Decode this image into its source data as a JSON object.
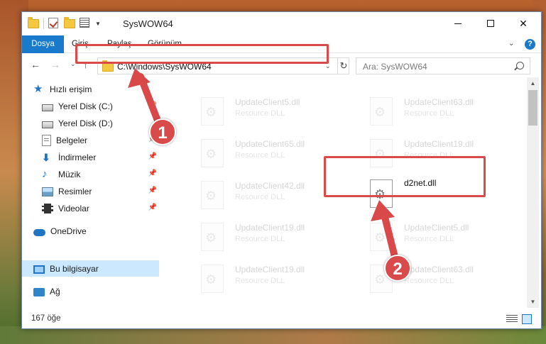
{
  "window": {
    "title": "SysWOW64"
  },
  "ribbon": {
    "tabs": [
      "Dosya",
      "Giriş",
      "Paylaş",
      "Görünüm"
    ]
  },
  "navbar": {
    "address": "C:\\Windows\\SysWOW64",
    "search_placeholder": "Ara: SysWOW64"
  },
  "sidebar": {
    "items": [
      {
        "label": "Hızlı erişim",
        "icon": "star-icon"
      },
      {
        "label": "Yerel Disk (C:)",
        "icon": "disk-icon"
      },
      {
        "label": "Yerel Disk (D:)",
        "icon": "disk-icon"
      },
      {
        "label": "Belgeler",
        "icon": "documents-icon"
      },
      {
        "label": "İndirmeler",
        "icon": "downloads-icon"
      },
      {
        "label": "Müzik",
        "icon": "music-icon"
      },
      {
        "label": "Resimler",
        "icon": "pictures-icon"
      },
      {
        "label": "Videolar",
        "icon": "videos-icon"
      },
      {
        "label": "OneDrive",
        "icon": "cloud-icon"
      },
      {
        "label": "Bu bilgisayar",
        "icon": "computer-icon"
      },
      {
        "label": "Ağ",
        "icon": "network-icon"
      }
    ]
  },
  "files": [
    {
      "name": "UpdateClient5.dll",
      "desc": "Resource DLL"
    },
    {
      "name": "UpdateClient63.dll",
      "desc": "Resource DLL"
    },
    {
      "name": "UpdateClient65.dll",
      "desc": "Resource DLL"
    },
    {
      "name": "UpdateClient19.dll",
      "desc": "Resource DLL"
    },
    {
      "name": "UpdateClient42.dll",
      "desc": "Resource DLL"
    },
    {
      "name": "d2net.dll",
      "desc": ""
    },
    {
      "name": "UpdateClient19.dll",
      "desc": "Resource DLL"
    },
    {
      "name": "UpdateClient5.dll",
      "desc": "Resource DLL"
    },
    {
      "name": "UpdateClient19.dll",
      "desc": "Resource DLL"
    },
    {
      "name": "UpdateClient63.dll",
      "desc": "Resource DLL"
    }
  ],
  "status": {
    "item_count": "167 öğe"
  },
  "callouts": {
    "one": "1",
    "two": "2"
  },
  "colors": {
    "accent": "#1979ca",
    "highlight": "#d94a4a",
    "selected_bg": "#cce8ff"
  }
}
